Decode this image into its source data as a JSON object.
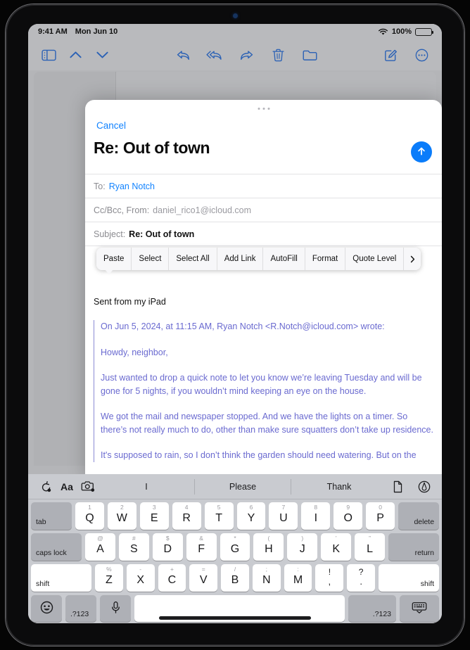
{
  "status_bar": {
    "time": "9:41 AM",
    "date": "Mon Jun 10",
    "battery_percent": "100%",
    "wifi_icon": "wifi-icon",
    "battery_icon": "battery-icon"
  },
  "mail_toolbar": {
    "icons": [
      {
        "name": "sidebar-toggle-icon",
        "label": "Sidebar"
      },
      {
        "name": "chevron-up-icon",
        "label": "Previous Message"
      },
      {
        "name": "chevron-down-icon",
        "label": "Next Message"
      },
      {
        "name": "reply-icon",
        "label": "Reply"
      },
      {
        "name": "reply-all-icon",
        "label": "Reply All"
      },
      {
        "name": "forward-icon",
        "label": "Forward"
      },
      {
        "name": "trash-icon",
        "label": "Delete"
      },
      {
        "name": "folder-icon",
        "label": "Move to Folder"
      },
      {
        "name": "compose-icon",
        "label": "New Message"
      },
      {
        "name": "more-icon",
        "label": "More"
      }
    ]
  },
  "compose_sheet": {
    "cancel_label": "Cancel",
    "title": "Re: Out of town",
    "send_icon": "send-arrow-up-icon",
    "grabber": "sheet-grabber",
    "fields": {
      "to_label": "To:",
      "to_value": "Ryan Notch",
      "cc_label": "Cc/Bcc, From:",
      "cc_value": "daniel_rico1@icloud.com",
      "subject_label": "Subject:",
      "subject_value": "Re: Out of town"
    },
    "context_menu": {
      "items": [
        "Paste",
        "Select",
        "Select All",
        "Add Link",
        "AutoFill",
        "Format",
        "Quote Level"
      ],
      "more_icon": "chevron-right-icon"
    },
    "body": {
      "signature": "Sent from my iPad",
      "quoted": [
        "On Jun 5, 2024, at 11:15 AM, Ryan Notch <R.Notch@icloud.com> wrote:",
        "Howdy, neighbor,",
        "Just wanted to drop a quick note to let you know we’re leaving Tuesday and will be gone for 5 nights, if you wouldn’t mind keeping an eye on the house.",
        "We got the mail and newspaper stopped. And we have the lights on a timer. So there’s not really much to do, other than make sure squatters don’t take up residence.",
        "It's supposed to rain, so I don’t think the garden should need watering. But on the"
      ]
    }
  },
  "keyboard": {
    "predictive": {
      "left_icons": [
        {
          "name": "undo-icon",
          "label": "Undo"
        },
        {
          "name": "text-format-icon",
          "label": "Aa"
        },
        {
          "name": "camera-icon",
          "label": "Insert Photo"
        }
      ],
      "suggestions": [
        "I",
        "Please",
        "Thank"
      ],
      "right_icons": [
        {
          "name": "document-icon",
          "label": "Insert Document"
        },
        {
          "name": "markup-icon",
          "label": "Markup"
        }
      ]
    },
    "rows": [
      {
        "name": "row-1",
        "keys": [
          {
            "name": "key-tab",
            "main": "tab",
            "alt": "",
            "type": "mod-left"
          },
          {
            "name": "key-q",
            "main": "Q",
            "alt": "1",
            "type": "letter"
          },
          {
            "name": "key-w",
            "main": "W",
            "alt": "2",
            "type": "letter"
          },
          {
            "name": "key-e",
            "main": "E",
            "alt": "3",
            "type": "letter"
          },
          {
            "name": "key-r",
            "main": "R",
            "alt": "4",
            "type": "letter"
          },
          {
            "name": "key-t",
            "main": "T",
            "alt": "5",
            "type": "letter"
          },
          {
            "name": "key-y",
            "main": "Y",
            "alt": "6",
            "type": "letter"
          },
          {
            "name": "key-u",
            "main": "U",
            "alt": "7",
            "type": "letter"
          },
          {
            "name": "key-i",
            "main": "I",
            "alt": "8",
            "type": "letter"
          },
          {
            "name": "key-o",
            "main": "O",
            "alt": "9",
            "type": "letter"
          },
          {
            "name": "key-p",
            "main": "P",
            "alt": "0",
            "type": "letter"
          },
          {
            "name": "key-delete",
            "main": "delete",
            "alt": "",
            "type": "mod-right"
          }
        ]
      },
      {
        "name": "row-2",
        "keys": [
          {
            "name": "key-caps-lock",
            "main": "caps lock",
            "alt": "",
            "type": "mod-left"
          },
          {
            "name": "key-a",
            "main": "A",
            "alt": "@",
            "type": "letter"
          },
          {
            "name": "key-s",
            "main": "S",
            "alt": "#",
            "type": "letter"
          },
          {
            "name": "key-d",
            "main": "D",
            "alt": "$",
            "type": "letter"
          },
          {
            "name": "key-f",
            "main": "F",
            "alt": "&",
            "type": "letter"
          },
          {
            "name": "key-g",
            "main": "G",
            "alt": "*",
            "type": "letter"
          },
          {
            "name": "key-h",
            "main": "H",
            "alt": "(",
            "type": "letter"
          },
          {
            "name": "key-j",
            "main": "J",
            "alt": ")",
            "type": "letter"
          },
          {
            "name": "key-k",
            "main": "K",
            "alt": "’",
            "type": "letter"
          },
          {
            "name": "key-l",
            "main": "L",
            "alt": "”",
            "type": "letter"
          },
          {
            "name": "key-return",
            "main": "return",
            "alt": "",
            "type": "mod-right"
          }
        ]
      },
      {
        "name": "row-3",
        "keys": [
          {
            "name": "key-shift-left",
            "main": "shift",
            "alt": "",
            "type": "shift-left"
          },
          {
            "name": "key-z",
            "main": "Z",
            "alt": "%",
            "type": "letter"
          },
          {
            "name": "key-x",
            "main": "X",
            "alt": "-",
            "type": "letter"
          },
          {
            "name": "key-c",
            "main": "C",
            "alt": "+",
            "type": "letter"
          },
          {
            "name": "key-v",
            "main": "V",
            "alt": "=",
            "type": "letter"
          },
          {
            "name": "key-b",
            "main": "B",
            "alt": "/",
            "type": "letter"
          },
          {
            "name": "key-n",
            "main": "N",
            "alt": ";",
            "type": "letter"
          },
          {
            "name": "key-m",
            "main": "M",
            "alt": ":",
            "type": "letter"
          },
          {
            "name": "key-comma",
            "main": ",",
            "alt": "!",
            "type": "punct"
          },
          {
            "name": "key-period",
            "main": ".",
            "alt": "?",
            "type": "punct"
          },
          {
            "name": "key-shift-right",
            "main": "shift",
            "alt": "",
            "type": "shift-right"
          }
        ]
      },
      {
        "name": "row-4",
        "keys": [
          {
            "name": "key-emoji",
            "main": "☺",
            "alt": "",
            "type": "emoji"
          },
          {
            "name": "key-numbers-left",
            "main": ".?123",
            "alt": "",
            "type": "num-left"
          },
          {
            "name": "key-dictation",
            "main": "",
            "alt": "",
            "type": "mic"
          },
          {
            "name": "key-space",
            "main": "",
            "alt": "",
            "type": "space"
          },
          {
            "name": "key-numbers-right",
            "main": ".?123",
            "alt": "",
            "type": "num-right"
          },
          {
            "name": "key-dismiss-keyboard",
            "main": "",
            "alt": "",
            "type": "dismiss"
          }
        ]
      }
    ]
  },
  "colors": {
    "accent_blue": "#0a7cfa",
    "link_blue": "#1283ff",
    "quote_purple": "#6a6ad0",
    "toolbar_blue": "#2c62b5",
    "keyboard_bg": "#c9cbd0"
  }
}
